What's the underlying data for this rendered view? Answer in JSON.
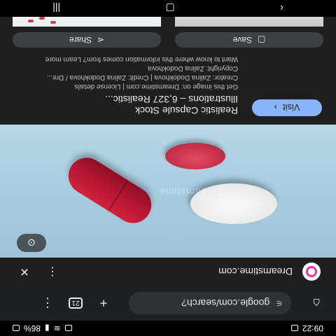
{
  "status_bar": {
    "time": "09:22",
    "battery": "86%"
  },
  "toolbar": {
    "url": "google.com/search?"
  },
  "source": {
    "name": "Dreamstime.com"
  },
  "image": {
    "watermark": "dreamstime"
  },
  "info": {
    "visit_label": "Visit",
    "title_line1": "Realistic Capsule Stock",
    "title_line2": "Illustrations – 6,327 Realistic...",
    "meta_line1": "Get this image on: Dreamstime.com | License details",
    "meta_line2": "Creator: Zalina Dodokhova | Credit: Zalina Dodokhova / Dre...",
    "meta_line3": "Copyright: Zalina Dodokhova",
    "meta_line4": "Want to know where this information comes from? Learn more"
  },
  "actions": {
    "share_label": "Share",
    "save_label": "Save"
  },
  "colors": {
    "accent": "#8ab4f8",
    "capsule": "#c21a36",
    "background": "#1f1f1f"
  }
}
